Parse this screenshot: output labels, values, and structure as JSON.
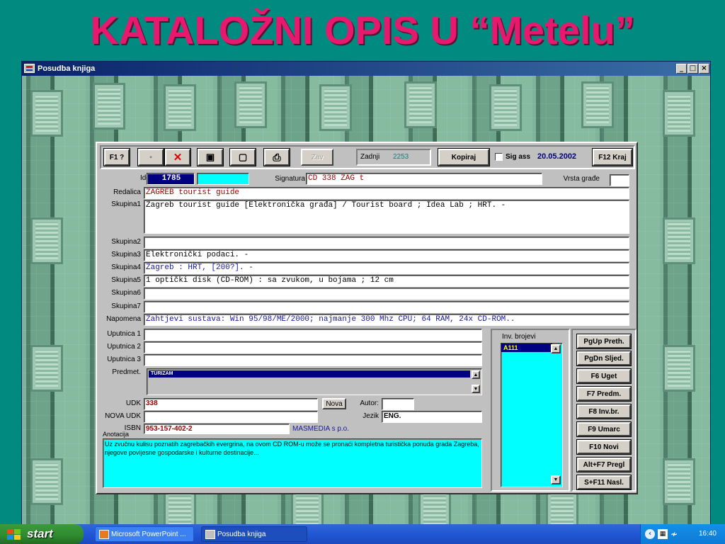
{
  "slide": {
    "title": "KATALOŽNI OPIS U “Metelu”"
  },
  "window": {
    "title": "Posudba knjiga",
    "min_glyph": "_",
    "max_glyph": "□",
    "close_glyph": "×"
  },
  "toolbar": {
    "f1": "F1 ?",
    "delete_glyph": "✕",
    "save_glyph": "▣",
    "new_glyph": "▢",
    "print_glyph": "⎙",
    "zav": "Zav",
    "zadnji_label": "Zadnji",
    "zadnji_value": "2253",
    "kopiraj": "Kopiraj",
    "sig_ass": "Sig ass",
    "date": "20.05.2002",
    "f12": "F12 Kraj"
  },
  "record": {
    "ident_label": "Ident.",
    "ident_value": "1785",
    "signatura_label": "Signatura",
    "signatura_value": "CD 338 ZAG t",
    "vrsta_label": "Vrsta građe",
    "vrsta_value": "",
    "redalica_label": "Redalica",
    "redalica_value": "ZAGREB tourist guide",
    "skupina1_label": "Skupina1",
    "skupina1_value": "Zagreb tourist guide [Elektronička građa] / Tourist board ; Idea Lab ; HRT. -",
    "skupina2_label": "Skupina2",
    "skupina2_value": "",
    "skupina3_label": "Skupina3",
    "skupina3_value": "Elektronički podaci. -",
    "skupina4_label": "Skupina4",
    "skupina4_value": "Zagreb : HRT, [200?]. -",
    "skupina5_label": "Skupina5",
    "skupina5_value": "1 optički disk (CD-ROM) : sa zvukom, u bojama ; 12 cm",
    "skupina6_label": "Skupina6",
    "skupina6_value": "",
    "skupina7_label": "Skupina7",
    "skupina7_value": "",
    "napomena_label": "Napomena",
    "napomena_value": "Zahtjevi sustava: Win 95/98/ME/2000; najmanje 300 Mhz CPU; 64 RAM, 24x CD-ROM..",
    "uputnica1_label": "Uputnica 1",
    "uputnica2_label": "Uputnica 2",
    "uputnica3_label": "Uputnica 3",
    "predmet_label": "Predmet.",
    "predmet_item": "TURIZAM",
    "udk_label": "UDK",
    "udk_value": "338",
    "nova_btn": "Nova",
    "nova_udk_label": "NOVA UDK",
    "nova_udk_value": "",
    "autor_label": "Autor:",
    "autor_value": "",
    "jezik_label": "Jezik",
    "jezik_value": "ENG.",
    "isbn_label": "ISBN",
    "isbn_value": "953-157-402-2",
    "publisher": "MASMEDIA s p.o.",
    "anotacija_label": "Anotacija",
    "anotacija_value": "Uz zvučnu kulisu poznatih zagrebačkih evergrina, na ovom CD ROM-u može se pronaći kompletna turistička ponuda grada Zagreba, njegove povijesne gospodarske i kulturne destinacije..."
  },
  "inv": {
    "label": "Inv. brojevi",
    "item": "A111"
  },
  "side_buttons": {
    "b1": "PgUp Preth.",
    "b2": "PgDn Sljed.",
    "b3": "F6 Uget",
    "b4": "F7 Predm.",
    "b5": "F8 Inv.br.",
    "b6": "F9 Umarc",
    "b7": "F10 Novi",
    "b8": "Alt+F7 Pregl",
    "b9": "S+F11 Nasl."
  },
  "taskbar": {
    "start": "start",
    "task1": "Microsoft PowerPoint ...",
    "task2": "Posudba knjiga",
    "clock": "16:40"
  },
  "colors": {
    "title": "#e6196e",
    "slide_bg": "#008a80",
    "cyan": "#00ffff",
    "dark_blue": "#000080"
  }
}
